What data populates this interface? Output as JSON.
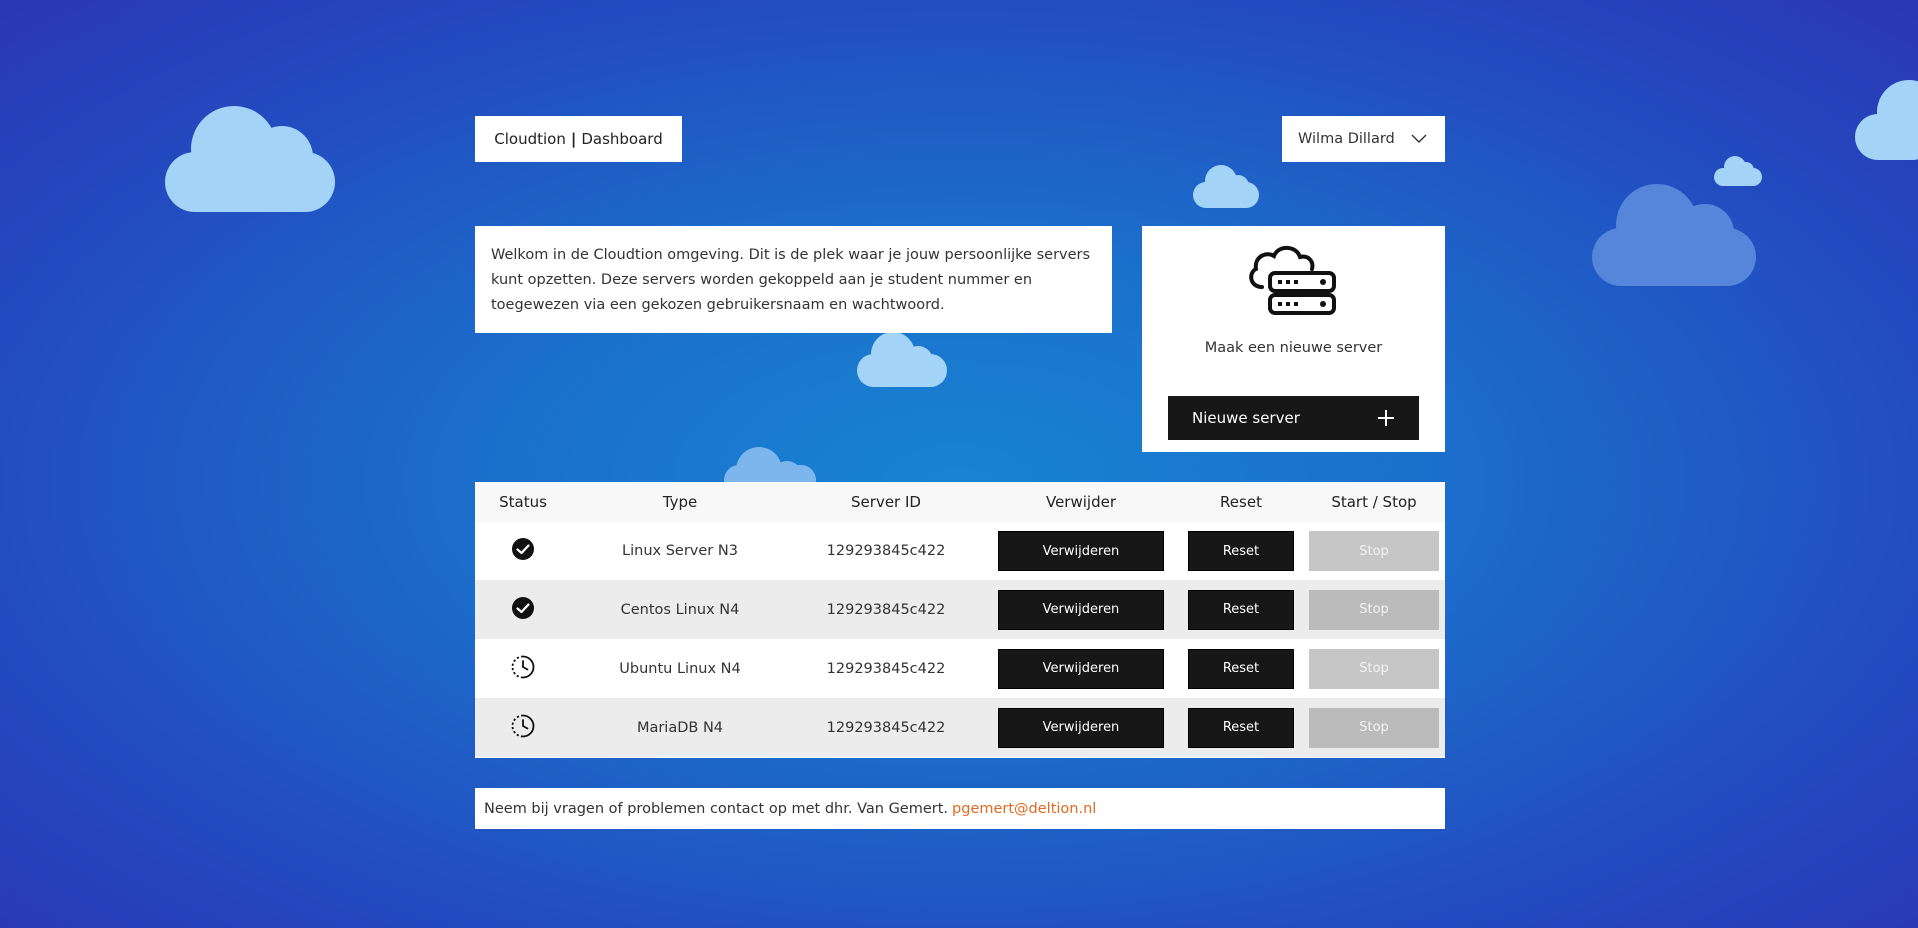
{
  "header": {
    "brand_name": "Cloudtion",
    "brand_separator": "|",
    "page_name": "Dashboard",
    "user_name": "Wilma Dillard"
  },
  "welcome": {
    "text": "Welkom in de Cloudtion omgeving. Dit is de plek waar je jouw persoonlijke servers kunt opzetten. Deze servers worden gekoppeld aan je student nummer en toegewezen via een gekozen gebruikersnaam en wachtwoord."
  },
  "new_server": {
    "caption": "Maak een nieuwe server",
    "button_label": "Nieuwe server",
    "icon": "cloud-server-icon"
  },
  "table": {
    "headers": [
      "Status",
      "Type",
      "Server ID",
      "Verwijder",
      "Reset",
      "Start / Stop"
    ],
    "rows": [
      {
        "status": "running",
        "status_icon": "check-circle-icon",
        "type": "Linux Server N3",
        "server_id": "129293845c422",
        "delete_label": "Verwijderen",
        "reset_label": "Reset",
        "toggle_label": "Stop"
      },
      {
        "status": "running",
        "status_icon": "check-circle-icon",
        "type": "Centos Linux N4",
        "server_id": "129293845c422",
        "delete_label": "Verwijderen",
        "reset_label": "Reset",
        "toggle_label": "Stop"
      },
      {
        "status": "pending",
        "status_icon": "clock-pending-icon",
        "type": "Ubuntu Linux N4",
        "server_id": "129293845c422",
        "delete_label": "Verwijderen",
        "reset_label": "Reset",
        "toggle_label": "Stop"
      },
      {
        "status": "pending",
        "status_icon": "clock-pending-icon",
        "type": "MariaDB N4",
        "server_id": "129293845c422",
        "delete_label": "Verwijderen",
        "reset_label": "Reset",
        "toggle_label": "Stop"
      }
    ]
  },
  "footer": {
    "text": "Neem bij vragen of problemen contact op met dhr. Van Gemert.",
    "email": "pgemert@deltion.nl"
  },
  "colors": {
    "background_center": "#1884d1",
    "background_edge": "#2b37b5",
    "button_dark": "#171717",
    "button_disabled": "#c6c6c6",
    "link": "#e06a23",
    "cloud": "#a3d4f7"
  }
}
